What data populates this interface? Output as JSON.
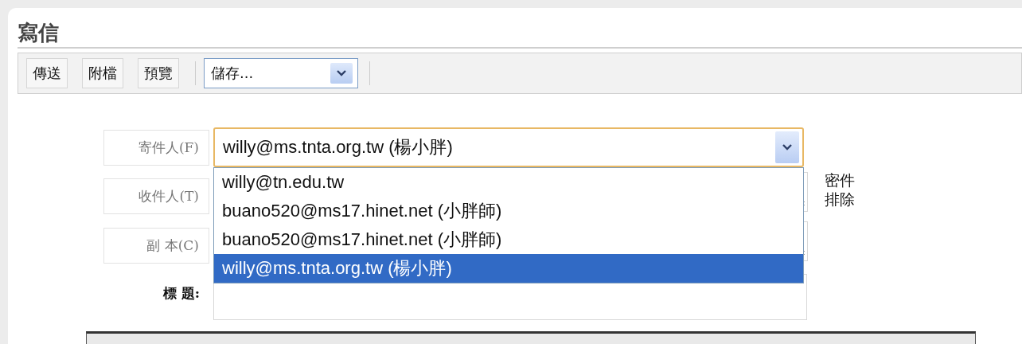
{
  "title": "寫信",
  "toolbar": {
    "buttons": [
      "傳送",
      "附檔",
      "預覽"
    ],
    "save_select": {
      "value": "儲存..."
    }
  },
  "form": {
    "from": {
      "label": "寄件人(F)",
      "value": "willy@ms.tnta.org.tw (楊小胖)",
      "expanded": true,
      "options": [
        {
          "label": "willy@tn.edu.tw",
          "selected": false
        },
        {
          "label": "buano520@ms17.hinet.net (小胖師)",
          "selected": false
        },
        {
          "label": "buano520@ms17.hinet.net (小胖師)",
          "selected": false
        },
        {
          "label": "willy@ms.tnta.org.tw (楊小胖)",
          "selected": true
        }
      ]
    },
    "to": {
      "label": "收件人(T)"
    },
    "cc": {
      "label": "副 本(C)"
    },
    "subject": {
      "label": "標 題:"
    },
    "side_links": [
      "密件",
      "排除"
    ]
  }
}
